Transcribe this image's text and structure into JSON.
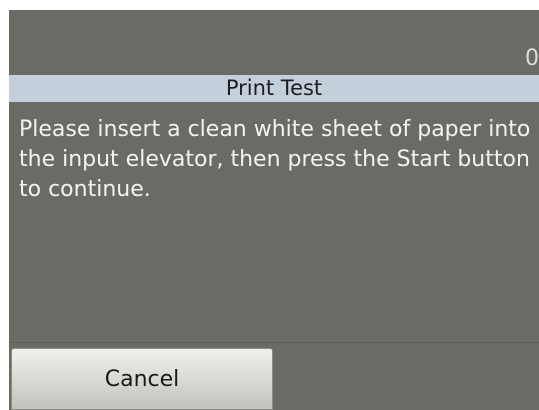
{
  "status": {
    "counter": "0"
  },
  "dialog": {
    "title": "Print Test",
    "message": "Please insert a clean white sheet of paper into the input elevator, then press the Start button to continue."
  },
  "buttons": {
    "cancel_label": "Cancel"
  },
  "colors": {
    "screen_background": "#6a6b65",
    "title_bar": "#c3d0dc",
    "message_text": "#f2f2f0",
    "button_face": "#d8d8d3"
  }
}
